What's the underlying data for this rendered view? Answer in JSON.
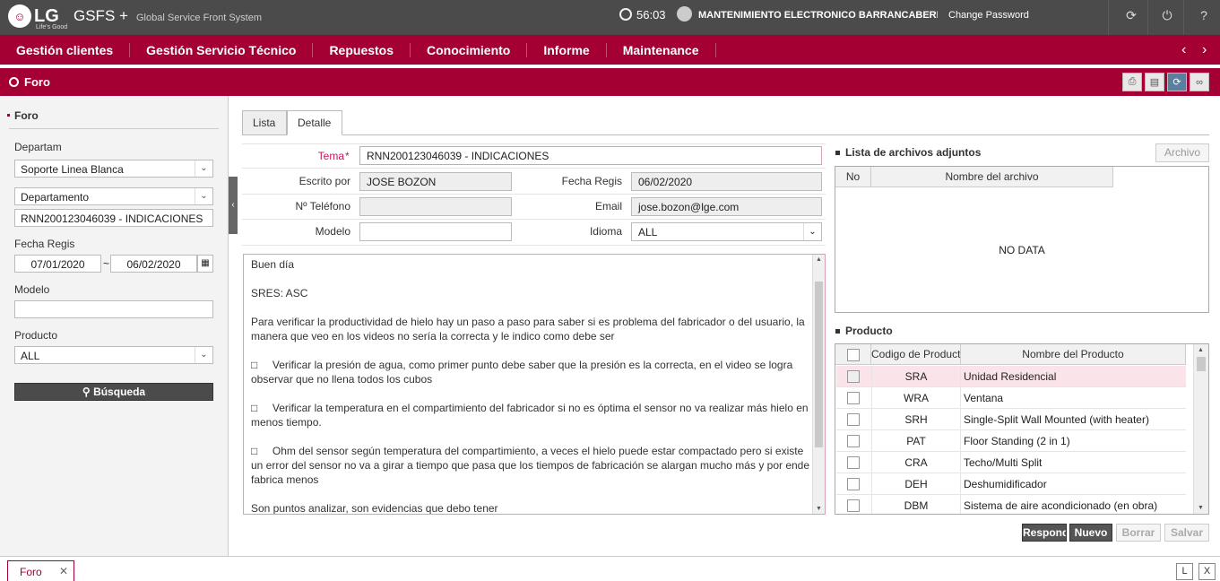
{
  "header": {
    "logo_text": "LG",
    "logo_tagline": "Life's Good",
    "app_name": "GSFS +",
    "app_subtitle": "Global Service Front System",
    "timer": "56:03",
    "user_name": "MANTENIMIENTO ELECTRONICO BARRANCABERMEJA",
    "change_password": "Change Password",
    "icons": [
      "refresh-icon",
      "power-icon",
      "help-icon"
    ]
  },
  "nav": {
    "items": [
      "Gestión clientes",
      "Gestión Servicio Técnico",
      "Repuestos",
      "Conocimiento",
      "Informe",
      "Maintenance"
    ]
  },
  "page": {
    "title": "Foro",
    "toolbar_icons": [
      "print-icon",
      "excel-icon",
      "refresh-icon",
      "link-icon"
    ]
  },
  "sidebar": {
    "title": "Foro",
    "departam_label": "Departam",
    "departam_value": "Soporte Linea Blanca",
    "departamento_value": "Departamento",
    "search_text": "RNN200123046039 - INDICACIONES",
    "fecha_label": "Fecha Regis",
    "fecha_from": "07/01/2020",
    "fecha_sep": "~",
    "fecha_to": "06/02/2020",
    "modelo_label": "Modelo",
    "modelo_value": "",
    "producto_label": "Producto",
    "producto_value": "ALL",
    "search_button": "Búsqueda"
  },
  "tabs": [
    "Lista",
    "Detalle"
  ],
  "form": {
    "tema_label": "Tema",
    "tema_value": "RNN200123046039 - INDICACIONES",
    "escrito_label": "Escrito por",
    "escrito_value": "JOSE BOZON",
    "fecha_label": "Fecha Regis",
    "fecha_value": "06/02/2020",
    "telefono_label": "Nº Teléfono",
    "telefono_value": "",
    "email_label": "Email",
    "email_value": "jose.bozon@lge.com",
    "modelo_label": "Modelo",
    "modelo_value": "",
    "idioma_label": "Idioma",
    "idioma_value": "ALL"
  },
  "body_text": {
    "p1": "Buen día",
    "p2": "SRES: ASC",
    "p3": "Para verificar la productividad de hielo hay un paso a paso para saber si es problema del fabricador o del usuario, la manera que veo en los videos no sería la correcta y le indico como debe ser",
    "p4": "□     Verificar la presión de agua, como primer punto debe saber que la presión es la correcta, en el video se logra observar que no llena todos los cubos",
    "p5": "□     Verificar la temperatura en el compartimiento del fabricador si no es óptima el sensor no va realizar más hielo en menos tiempo.",
    "p6": "□     Ohm del sensor según temperatura del compartimiento, a veces el hielo puede estar compactado pero si existe un error del sensor no va a girar a tiempo que pasa que los tiempos de fabricación se alargan mucho más y por ende fabrica menos",
    "p7": "Son puntos analizar, son evidencias que debo tener"
  },
  "attachments": {
    "title": "Lista de archivos adjuntos",
    "button": "Archivo",
    "col_no": "No",
    "col_name": "Nombre del archivo",
    "empty": "NO DATA"
  },
  "products": {
    "title": "Producto",
    "col_code": "Codigo de Producto",
    "col_name": "Nombre del Producto",
    "rows": [
      {
        "code": "SRA",
        "name": "Unidad Residencial"
      },
      {
        "code": "WRA",
        "name": "Ventana"
      },
      {
        "code": "SRH",
        "name": "Single-Split Wall Mounted (with heater)"
      },
      {
        "code": "PAT",
        "name": "Floor Standing (2 in 1)"
      },
      {
        "code": "CRA",
        "name": "Techo/Multi Split"
      },
      {
        "code": "DEH",
        "name": "Deshumidificador"
      },
      {
        "code": "DBM",
        "name": "Sistema de aire acondicionado (en obra)"
      }
    ]
  },
  "actions": {
    "respond": "Responder",
    "nuevo": "Nuevo",
    "borrar": "Borrar",
    "salvar": "Salvar"
  },
  "bottom": {
    "tab_label": "Foro",
    "btn_l": "L",
    "btn_x": "X"
  },
  "colors": {
    "brand": "#a50034",
    "header_bg": "#4b4b4b",
    "selected_row": "#fbe3ea"
  }
}
